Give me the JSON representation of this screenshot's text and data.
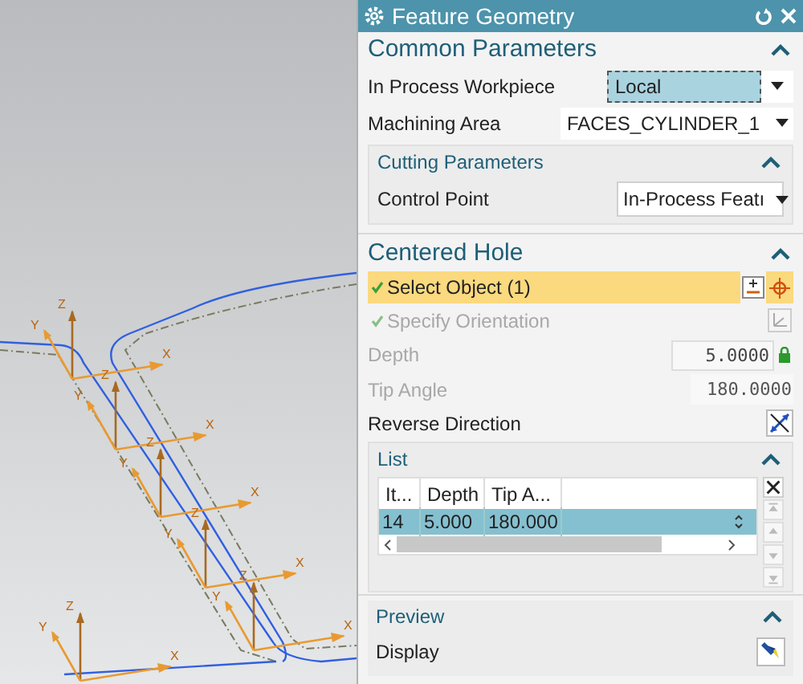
{
  "viewport": {
    "triads": [
      {
        "x": "X",
        "y": "Y",
        "z": "Z"
      },
      {
        "x": "X",
        "y": "Y",
        "z": "Z"
      },
      {
        "x": "X",
        "y": "Y",
        "z": "Z"
      },
      {
        "x": "X",
        "y": "Y",
        "z": "Z"
      },
      {
        "x": "X",
        "y": "Y",
        "z": "Z"
      },
      {
        "x": "X",
        "y": "Y",
        "z": "Z"
      }
    ]
  },
  "window": {
    "title": "Feature Geometry"
  },
  "common_parameters": {
    "title": "Common Parameters",
    "expanded": true,
    "fields": [
      {
        "label": "In Process Workpiece",
        "value": "Local",
        "focused": true
      },
      {
        "label": "Machining Area",
        "value": "FACES_CYLINDER_1",
        "focused": false
      }
    ],
    "cutting_parameters": {
      "title": "Cutting Parameters",
      "expanded": true,
      "control_point": {
        "label": "Control Point",
        "value": "In-Process Featı"
      }
    }
  },
  "centered_hole": {
    "title": "Centered Hole",
    "expanded": true,
    "select_object": {
      "label": "Select Object (1)",
      "selected": true,
      "done": true
    },
    "specify_orientation": {
      "label": "Specify Orientation",
      "disabled": true,
      "done": true
    },
    "depth": {
      "label": "Depth",
      "value": "5.0000",
      "locked": true
    },
    "tip_angle": {
      "label": "Tip Angle",
      "value": "180.0000"
    },
    "reverse_direction": {
      "label": "Reverse Direction"
    },
    "list": {
      "title": "List",
      "expanded": true,
      "columns": [
        "It...",
        "Depth",
        "Tip A..."
      ],
      "rows": [
        {
          "cells": [
            "14",
            "5.000",
            "180.000"
          ],
          "selected": true
        }
      ]
    },
    "preview": {
      "title": "Preview",
      "expanded": true,
      "display": {
        "label": "Display"
      }
    }
  }
}
